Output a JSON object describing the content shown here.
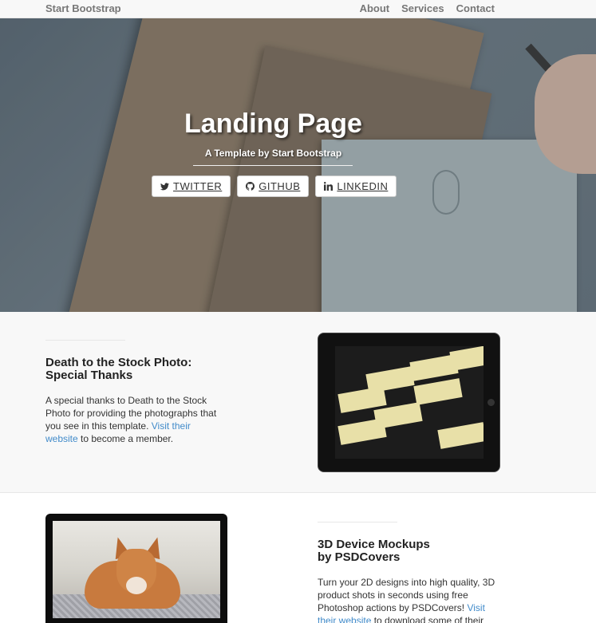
{
  "navbar": {
    "brand": "Start Bootstrap",
    "links": [
      "About",
      "Services",
      "Contact"
    ]
  },
  "hero": {
    "title": "Landing Page",
    "subtitle": "A Template by Start Bootstrap",
    "buttons": [
      {
        "label": "TWITTER",
        "icon": "twitter-icon"
      },
      {
        "label": "GITHUB",
        "icon": "github-icon"
      },
      {
        "label": "LINKEDIN",
        "icon": "linkedin-icon"
      }
    ]
  },
  "section1": {
    "heading_line1": "Death to the Stock Photo:",
    "heading_line2": "Special Thanks",
    "text_before_link": "A special thanks to Death to the Stock Photo for providing the photographs that you see in this template.",
    "link_text": "Visit their website",
    "text_after_link": "to become a member."
  },
  "section2": {
    "heading_line1": "3D Device Mockups",
    "heading_line2": "by PSDCovers",
    "text_before_link": "Turn your 2D designs into high quality, 3D product shots in seconds using free Photoshop actions by PSDCovers!",
    "link_text": "Visit their website",
    "text_after_link": "to download some of their"
  },
  "colors": {
    "link": "#428bca",
    "navbar_bg": "#f8f8f8",
    "nav_text": "#777777"
  }
}
